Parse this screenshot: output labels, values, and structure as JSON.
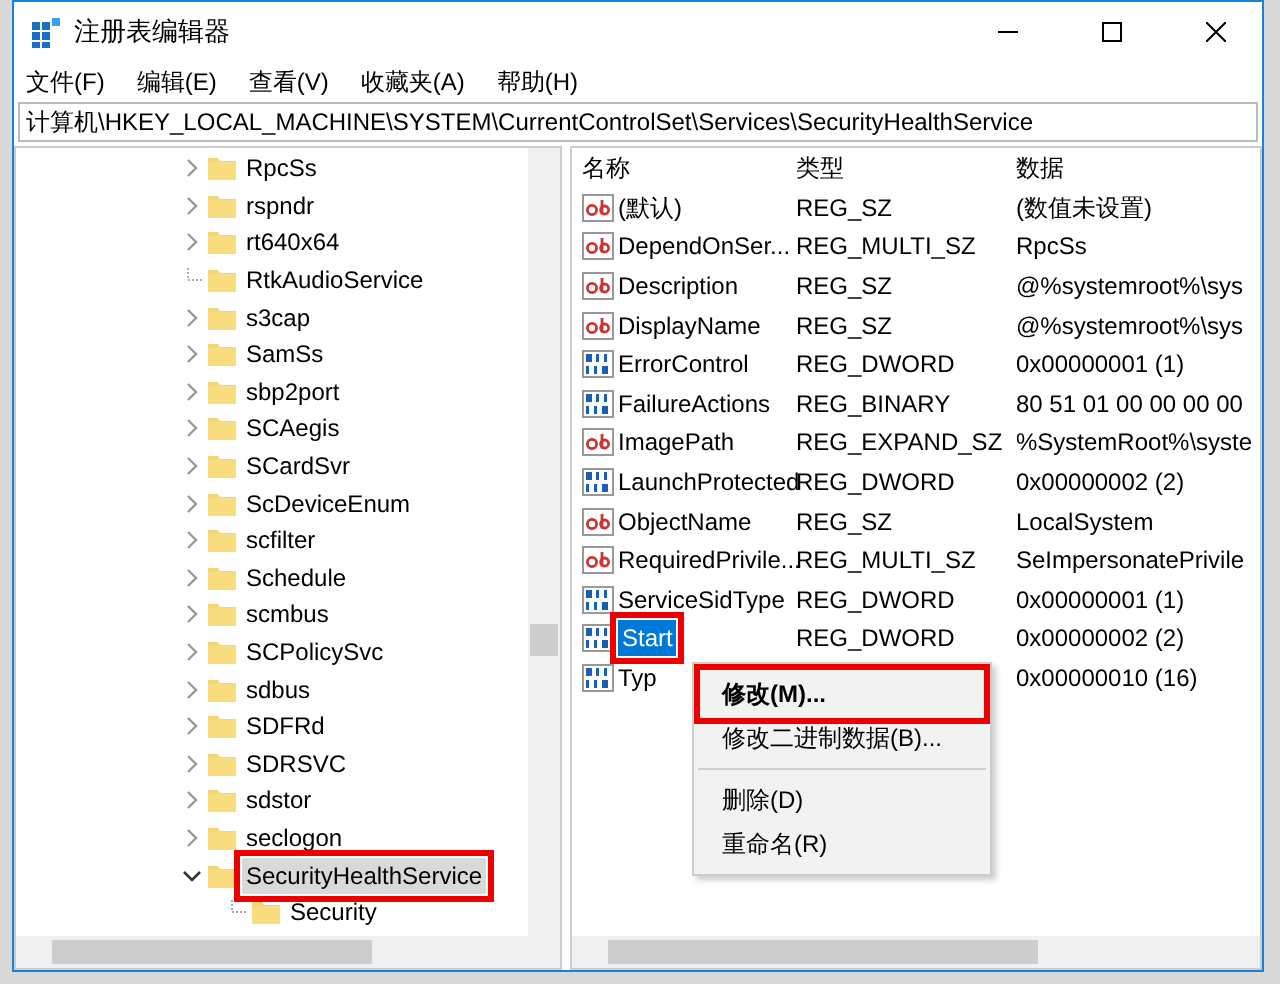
{
  "window": {
    "title": "注册表编辑器"
  },
  "menu": [
    "文件(F)",
    "编辑(E)",
    "查看(V)",
    "收藏夹(A)",
    "帮助(H)"
  ],
  "address": "计算机\\HKEY_LOCAL_MACHINE\\SYSTEM\\CurrentControlSet\\Services\\SecurityHealthService",
  "tree": {
    "items": [
      {
        "label": "RpcSs",
        "kind": "node",
        "expanded": false,
        "selected": false
      },
      {
        "label": "rspndr",
        "kind": "node",
        "expanded": false,
        "selected": false
      },
      {
        "label": "rt640x64",
        "kind": "node",
        "expanded": false,
        "selected": false
      },
      {
        "label": "RtkAudioService",
        "kind": "leaf",
        "selected": false
      },
      {
        "label": "s3cap",
        "kind": "node",
        "expanded": false,
        "selected": false
      },
      {
        "label": "SamSs",
        "kind": "node",
        "expanded": false,
        "selected": false
      },
      {
        "label": "sbp2port",
        "kind": "node",
        "expanded": false,
        "selected": false
      },
      {
        "label": "SCAegis",
        "kind": "node",
        "expanded": false,
        "selected": false
      },
      {
        "label": "SCardSvr",
        "kind": "node",
        "expanded": false,
        "selected": false
      },
      {
        "label": "ScDeviceEnum",
        "kind": "node",
        "expanded": false,
        "selected": false
      },
      {
        "label": "scfilter",
        "kind": "node",
        "expanded": false,
        "selected": false
      },
      {
        "label": "Schedule",
        "kind": "node",
        "expanded": false,
        "selected": false
      },
      {
        "label": "scmbus",
        "kind": "node",
        "expanded": false,
        "selected": false
      },
      {
        "label": "SCPolicySvc",
        "kind": "node",
        "expanded": false,
        "selected": false
      },
      {
        "label": "sdbus",
        "kind": "node",
        "expanded": false,
        "selected": false
      },
      {
        "label": "SDFRd",
        "kind": "node",
        "expanded": false,
        "selected": false
      },
      {
        "label": "SDRSVC",
        "kind": "node",
        "expanded": false,
        "selected": false
      },
      {
        "label": "sdstor",
        "kind": "node",
        "expanded": false,
        "selected": false
      },
      {
        "label": "seclogon",
        "kind": "node",
        "expanded": false,
        "selected": false
      },
      {
        "label": "SecurityHealthService",
        "kind": "node",
        "expanded": true,
        "selected": true,
        "annotated": true,
        "children": [
          {
            "label": "Security",
            "kind": "leaf",
            "selected": false
          }
        ]
      }
    ]
  },
  "values": {
    "columns": [
      "名称",
      "类型",
      "数据"
    ],
    "rows": [
      {
        "kind": "string",
        "name": "(默认)",
        "type": "REG_SZ",
        "data": "(数值未设置)",
        "selected": false
      },
      {
        "kind": "string",
        "name": "DependOnSer...",
        "type": "REG_MULTI_SZ",
        "data": "RpcSs",
        "selected": false
      },
      {
        "kind": "string",
        "name": "Description",
        "type": "REG_SZ",
        "data": "@%systemroot%\\sys",
        "selected": false
      },
      {
        "kind": "string",
        "name": "DisplayName",
        "type": "REG_SZ",
        "data": "@%systemroot%\\sys",
        "selected": false
      },
      {
        "kind": "binary",
        "name": "ErrorControl",
        "type": "REG_DWORD",
        "data": "0x00000001 (1)",
        "selected": false
      },
      {
        "kind": "binary",
        "name": "FailureActions",
        "type": "REG_BINARY",
        "data": "80 51 01 00 00 00 00",
        "selected": false
      },
      {
        "kind": "string",
        "name": "ImagePath",
        "type": "REG_EXPAND_SZ",
        "data": "%SystemRoot%\\syste",
        "selected": false
      },
      {
        "kind": "binary",
        "name": "LaunchProtected",
        "type": "REG_DWORD",
        "data": "0x00000002 (2)",
        "selected": false
      },
      {
        "kind": "string",
        "name": "ObjectName",
        "type": "REG_SZ",
        "data": "LocalSystem",
        "selected": false
      },
      {
        "kind": "string",
        "name": "RequiredPrivile...",
        "type": "REG_MULTI_SZ",
        "data": "SeImpersonatePrivile",
        "selected": false
      },
      {
        "kind": "binary",
        "name": "ServiceSidType",
        "type": "REG_DWORD",
        "data": "0x00000001 (1)",
        "selected": false
      },
      {
        "kind": "binary",
        "name": "Start",
        "type": "REG_DWORD",
        "data": "0x00000002 (2)",
        "selected": true,
        "annotated": true
      },
      {
        "kind": "binary",
        "name": "Typ",
        "data": "0x00000010 (16)",
        "selected": false
      }
    ]
  },
  "context_menu": [
    {
      "kind": "item",
      "label": "修改(M)...",
      "default": true,
      "annotated": true
    },
    {
      "kind": "item",
      "label": "修改二进制数据(B)...",
      "default": false
    },
    {
      "kind": "separator"
    },
    {
      "kind": "item",
      "label": "删除(D)",
      "default": false
    },
    {
      "kind": "item",
      "label": "重命名(R)",
      "default": false
    }
  ]
}
